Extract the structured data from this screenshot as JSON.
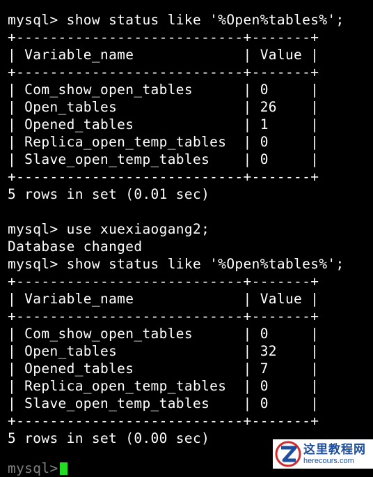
{
  "terminal": {
    "lines": [
      "mysql> show status like '%Open%tables%';",
      "+---------------------------+-------+",
      "| Variable_name             | Value |",
      "+---------------------------+-------+",
      "| Com_show_open_tables      | 0     |",
      "| Open_tables               | 26    |",
      "| Opened_tables             | 1     |",
      "| Replica_open_temp_tables  | 0     |",
      "| Slave_open_temp_tables    | 0     |",
      "+---------------------------+-------+",
      "5 rows in set (0.01 sec)",
      "",
      "mysql> use xuexiaogang2;",
      "Database changed",
      "mysql> show status like '%Open%tables%';",
      "+---------------------------+-------+",
      "| Variable_name             | Value |",
      "+---------------------------+-------+",
      "| Com_show_open_tables      | 0     |",
      "| Open_tables               | 32    |",
      "| Opened_tables             | 7     |",
      "| Replica_open_temp_tables  | 0     |",
      "| Slave_open_temp_tables    | 0     |",
      "+---------------------------+-------+",
      "5 rows in set (0.00 sec)",
      ""
    ],
    "prompt": "mysql>",
    "cursor_color": "#22dd22",
    "text_color": "#ffffff",
    "background": "#000000"
  },
  "watermark": {
    "title": "这里教程网",
    "domain": "herecours.com",
    "icon": "z-logo-icon"
  }
}
